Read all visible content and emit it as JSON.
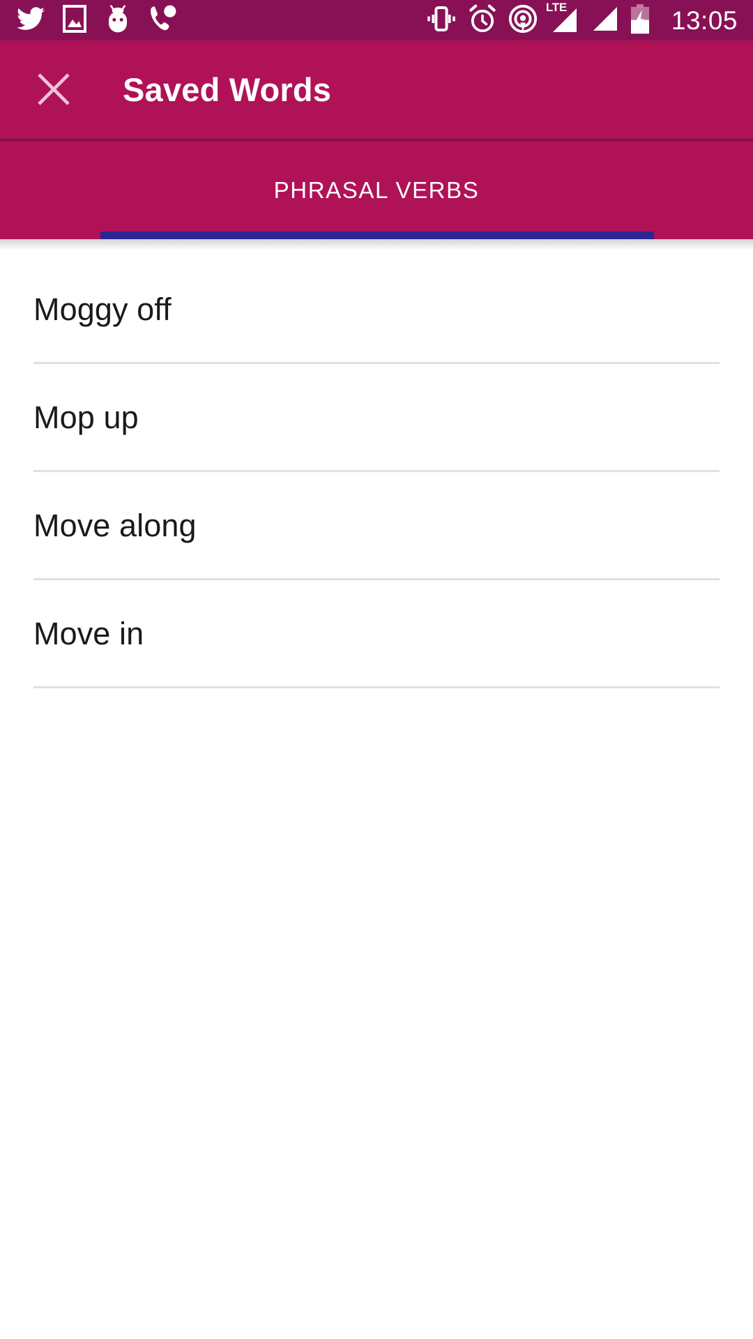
{
  "status_bar": {
    "background_color": "#881155",
    "time": "13:05",
    "left_icons": [
      {
        "name": "twitter-icon",
        "label": "Twitter notification"
      },
      {
        "name": "screenshot-image-icon",
        "label": "Screenshot captured"
      },
      {
        "name": "android-marshmallow-icon",
        "label": "Android system"
      },
      {
        "name": "missed-call-icon",
        "label": "Missed call"
      }
    ],
    "right_icons": [
      {
        "name": "vibrate-icon",
        "label": "Vibrate mode"
      },
      {
        "name": "alarm-icon",
        "label": "Alarm set"
      },
      {
        "name": "hotspot-icon",
        "label": "Portable hotspot"
      },
      {
        "name": "signal-lte-icon",
        "label": "LTE",
        "network_label": "LTE"
      },
      {
        "name": "signal-sim2-icon",
        "label": "Signal SIM 2"
      },
      {
        "name": "battery-charging-icon",
        "label": "Battery charging"
      }
    ]
  },
  "app_bar": {
    "background_color": "#b01257",
    "close_label": "Close",
    "title": "Saved Words"
  },
  "tabs": {
    "background_color": "#b01257",
    "indicator_color": "#2e2597",
    "items": [
      {
        "label": "PHRASAL VERBS",
        "selected": true
      }
    ]
  },
  "list": {
    "background_color": "#ffffff",
    "divider_color": "#e0e0e0",
    "text_color": "#1a1a1a",
    "items": [
      {
        "label": "Moggy off"
      },
      {
        "label": "Mop up"
      },
      {
        "label": "Move along"
      },
      {
        "label": "Move in"
      }
    ]
  }
}
